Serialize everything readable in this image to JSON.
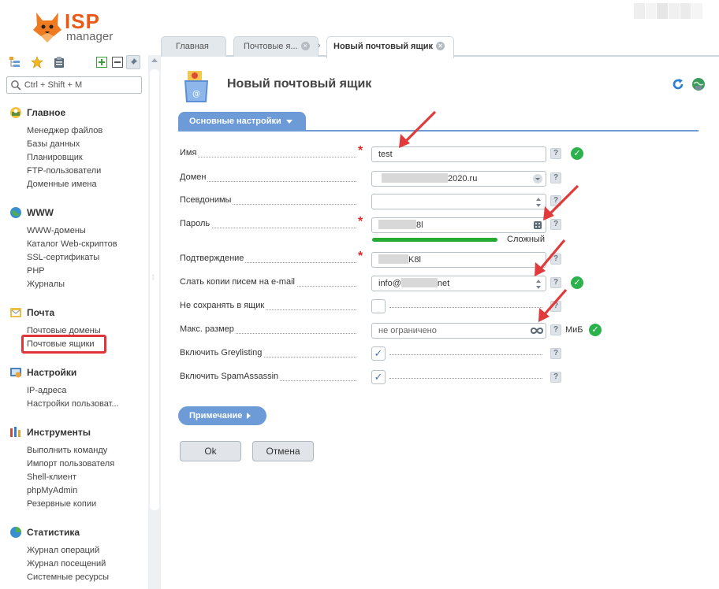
{
  "header": {
    "logo_isp": "ISP",
    "logo_manager": "manager"
  },
  "sidebar": {
    "search_placeholder": "Ctrl + Shift + M",
    "sections": [
      {
        "title": "Главное",
        "icon": "main-icon",
        "items": [
          "Менеджер файлов",
          "Базы данных",
          "Планировщик",
          "FTP-пользователи",
          "Доменные имена"
        ]
      },
      {
        "title": "WWW",
        "icon": "www-globe-icon",
        "items": [
          "WWW-домены",
          "Каталог Web-скриптов",
          "SSL-сертификаты",
          "PHP",
          "Журналы"
        ]
      },
      {
        "title": "Почта",
        "icon": "mail-icon",
        "items": [
          "Почтовые домены",
          "Почтовые ящики"
        ]
      },
      {
        "title": "Настройки",
        "icon": "settings-icon",
        "items": [
          "IP-адреса",
          "Настройки пользоват..."
        ]
      },
      {
        "title": "Инструменты",
        "icon": "tools-icon",
        "items": [
          "Выполнить команду",
          "Импорт пользователя",
          "Shell-клиент",
          "phpMyAdmin",
          "Резервные копии"
        ]
      },
      {
        "title": "Статистика",
        "icon": "stats-icon",
        "items": [
          "Журнал операций",
          "Журнал посещений",
          "Системные ресурсы"
        ]
      }
    ],
    "active_item": "Почтовые ящики"
  },
  "tabs": {
    "t1": "Главная",
    "t2": "Почтовые я...",
    "t3": "Новый почтовый ящик"
  },
  "main": {
    "title": "Новый почтовый ящик",
    "section_tab": "Основные настройки",
    "fields": {
      "name": {
        "label": "Имя",
        "value": "test"
      },
      "domain": {
        "label": "Домен",
        "value": "2020.ru"
      },
      "aliases": {
        "label": "Псевдонимы",
        "value": ""
      },
      "password": {
        "label": "Пароль",
        "value": "8l",
        "strength": "Сложный",
        "strength_level": 1.0
      },
      "confirm": {
        "label": "Подтверждение",
        "value": "K8l"
      },
      "copy_email": {
        "label": "Слать копии писем на e-mail",
        "value_prefix": "info@",
        "value_suffix": "net"
      },
      "dont_store": {
        "label": "Не сохранять в ящик",
        "checked": false
      },
      "max_size": {
        "label": "Макс. размер",
        "placeholder": "не ограничено",
        "unit": "МиБ"
      },
      "greylisting": {
        "label": "Включить Greylisting",
        "checked": true
      },
      "spamassassin": {
        "label": "Включить SpamAssassin",
        "checked": true
      }
    },
    "help_mark": "?",
    "note_button": "Примечание",
    "ok_button": "Ok",
    "cancel_button": "Отмена"
  },
  "colors": {
    "accent": "#6d9bd7",
    "ok_green": "#2bb24c",
    "required_red": "#e02828",
    "arrow_red": "#e03a3a",
    "logo_orange": "#e85a16"
  }
}
